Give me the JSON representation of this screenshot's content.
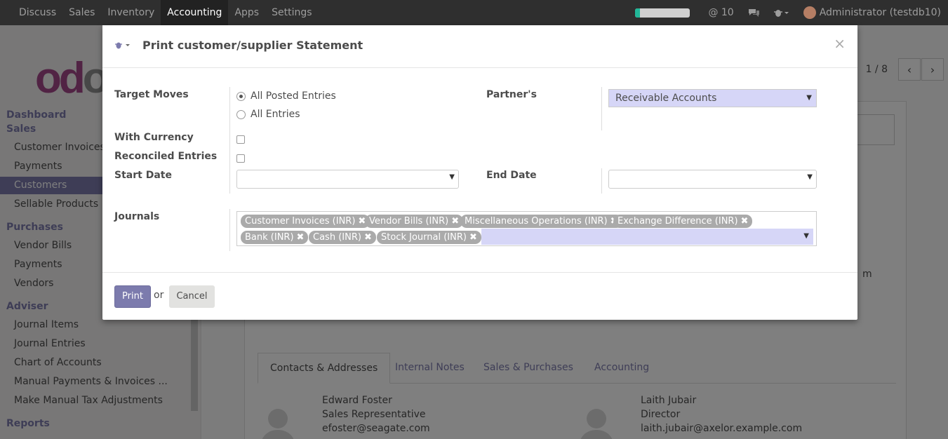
{
  "topbar": {
    "menu": [
      "Discuss",
      "Sales",
      "Inventory",
      "Accounting",
      "Apps",
      "Settings"
    ],
    "active": "Accounting",
    "mentions": "@ 10",
    "user": "Administrator (testdb10)",
    "progress": 0.08,
    "accent": "#21b799"
  },
  "sidebar": {
    "logo": "odoo",
    "sections": {
      "dashboard": "Dashboard",
      "sales": "Sales",
      "purchases": "Purchases",
      "adviser": "Adviser",
      "reports": "Reports"
    },
    "sales_items": [
      "Customer Invoices",
      "Payments",
      "Customers",
      "Sellable Products"
    ],
    "purchase_items": [
      "Vendor Bills",
      "Payments",
      "Vendors"
    ],
    "adviser_items": [
      "Journal Items",
      "Journal Entries",
      "Chart of Accounts",
      "Manual Payments & Invoices ...",
      "Make Manual Tax Adjustments"
    ]
  },
  "main": {
    "pager": "1 / 8",
    "tabs": [
      "Contacts & Addresses",
      "Internal Notes",
      "Sales & Purchases",
      "Accounting"
    ],
    "contacts": [
      {
        "name": "Edward Foster",
        "title": "Sales Representative",
        "email": "efoster@seagate.com"
      },
      {
        "name": "Laith Jubair",
        "title": "Director",
        "email": "laith.jubair@axelor.example.com"
      }
    ],
    "trailing_text": "m"
  },
  "dialog": {
    "title": "Print customer/supplier Statement",
    "close": "×",
    "target_moves_label": "Target Moves",
    "target_moves_options": [
      "All Posted Entries",
      "All Entries"
    ],
    "target_moves_selected": "All Posted Entries",
    "partners_label": "Partner's",
    "partners_value": "Receivable Accounts",
    "with_currency_label": "With Currency",
    "reconciled_label": "Reconciled Entries",
    "start_date_label": "Start Date",
    "end_date_label": "End Date",
    "journals_label": "Journals",
    "journals": [
      "Customer Invoices (INR)",
      "Vendor Bills (INR)",
      "Miscellaneous Operations (INR)",
      "Exchange Difference (INR)",
      "Bank (INR)",
      "Cash (INR)",
      "Stock Journal (INR)"
    ],
    "print_label": "Print",
    "or_label": "or",
    "cancel_label": "Cancel"
  },
  "colors": {
    "primary": "#7c7bad",
    "navbar": "#2f2f2f",
    "tag": "#aaaaaa",
    "select_bg": "#d6d6f7"
  }
}
